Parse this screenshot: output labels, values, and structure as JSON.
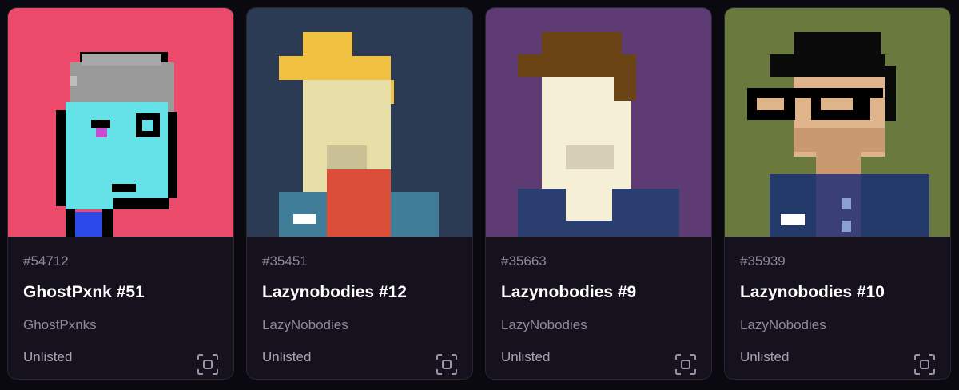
{
  "cards": [
    {
      "token_id": "#54712",
      "name": "GhostPxnk #51",
      "collection": "GhostPxnks",
      "status": "Unlisted",
      "bg": "#ec4a6b",
      "icon": "view-icon"
    },
    {
      "token_id": "#35451",
      "name": "Lazynobodies #12",
      "collection": "LazyNobodies",
      "status": "Unlisted",
      "bg": "#2b3b54",
      "icon": "view-icon"
    },
    {
      "token_id": "#35663",
      "name": "Lazynobodies #9",
      "collection": "LazyNobodies",
      "status": "Unlisted",
      "bg": "#5e3b72",
      "icon": "view-icon"
    },
    {
      "token_id": "#35939",
      "name": "Lazynobodies #10",
      "collection": "LazyNobodies",
      "status": "Unlisted",
      "bg": "#6a7a3e",
      "icon": "view-icon"
    }
  ]
}
